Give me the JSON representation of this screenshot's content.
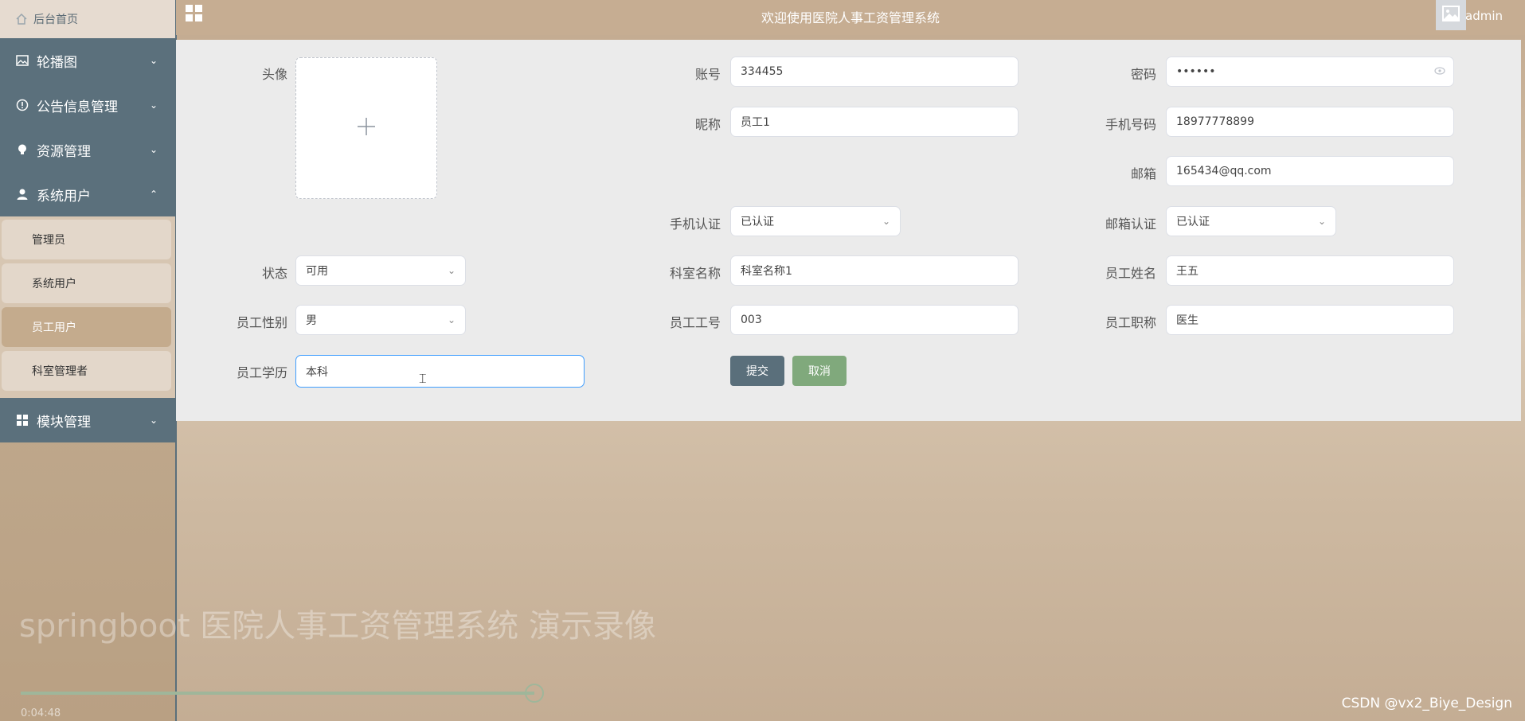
{
  "header": {
    "title": "欢迎使用医院人事工资管理系统",
    "username": "admin"
  },
  "sidebar": {
    "home": "后台首页",
    "menus": [
      {
        "label": "轮播图",
        "icon": "image-icon",
        "expanded": false
      },
      {
        "label": "公告信息管理",
        "icon": "info-icon",
        "expanded": false
      },
      {
        "label": "资源管理",
        "icon": "bulb-icon",
        "expanded": false
      },
      {
        "label": "系统用户",
        "icon": "user-icon",
        "expanded": true
      },
      {
        "label": "模块管理",
        "icon": "grid-icon",
        "expanded": false
      }
    ],
    "submenu": [
      {
        "label": "管理员",
        "active": false
      },
      {
        "label": "系统用户",
        "active": false
      },
      {
        "label": "员工用户",
        "active": true
      },
      {
        "label": "科室管理者",
        "active": false
      }
    ]
  },
  "form": {
    "avatar_label": "头像",
    "account_label": "账号",
    "account_value": "334455",
    "password_label": "密码",
    "password_value": "••••••",
    "nickname_label": "昵称",
    "nickname_value": "员工1",
    "phone_label": "手机号码",
    "phone_value": "18977778899",
    "email_label": "邮箱",
    "email_value": "165434@qq.com",
    "phone_verify_label": "手机认证",
    "phone_verify_value": "已认证",
    "email_verify_label": "邮箱认证",
    "email_verify_value": "已认证",
    "status_label": "状态",
    "status_value": "可用",
    "dept_label": "科室名称",
    "dept_value": "科室名称1",
    "emp_name_label": "员工姓名",
    "emp_name_value": "王五",
    "gender_label": "员工性别",
    "gender_value": "男",
    "emp_no_label": "员工工号",
    "emp_no_value": "003",
    "title_label": "员工职称",
    "title_value": "医生",
    "edu_label": "员工学历",
    "edu_value": "本科",
    "submit_label": "提交",
    "cancel_label": "取消"
  },
  "video": {
    "overlay_title": "springboot 医院人事工资管理系统 演示录像",
    "timecode": "0:04:48",
    "progress": 0.81
  },
  "credit": "CSDN @vx2_Biye_Design",
  "colors": {
    "sidebar_menu": "#5b707c",
    "accent_submit": "#5a6f7b",
    "accent_cancel": "#80a97c",
    "active_sub": "#c4ab8d"
  }
}
